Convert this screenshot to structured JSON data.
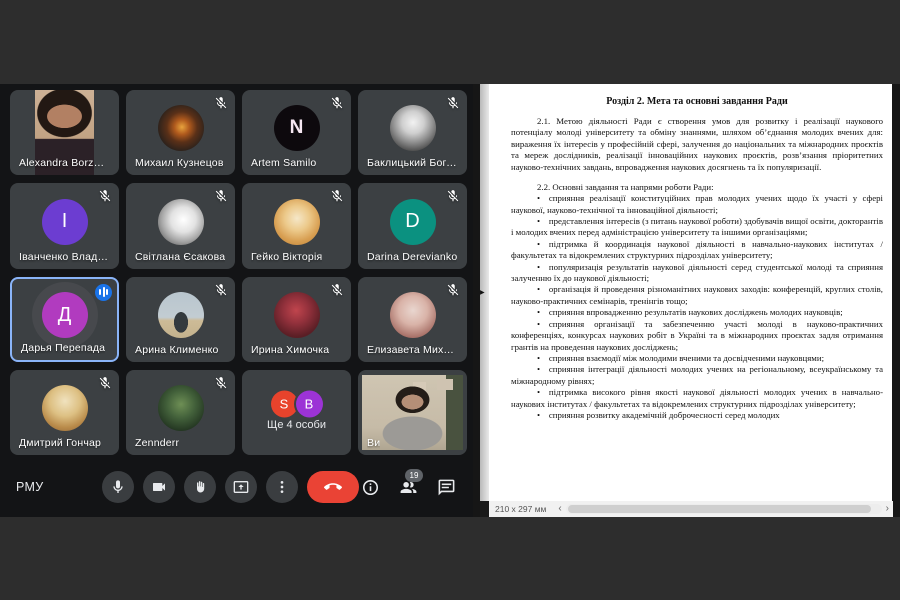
{
  "meet": {
    "room_label": "РМУ",
    "people_count_badge": "19",
    "participants": [
      {
        "name": "Alexandra Borzova",
        "kind": "video"
      },
      {
        "name": "Михаил Кузнецов",
        "kind": "photo",
        "muted": true
      },
      {
        "name": "Artem Samilo",
        "kind": "logo",
        "initial": "N",
        "muted": true
      },
      {
        "name": "Баклицький Богдан",
        "kind": "photo",
        "muted": true
      },
      {
        "name": "Іванченко Владисл...",
        "kind": "initial",
        "initial": "І",
        "color": "#6c3dd1",
        "muted": true
      },
      {
        "name": "Світлана Єсакова",
        "kind": "photo",
        "muted": true
      },
      {
        "name": "Гейко Вікторія",
        "kind": "photo",
        "muted": true
      },
      {
        "name": "Darina Derevianko",
        "kind": "initial",
        "initial": "D",
        "color": "#0b9180",
        "muted": true
      },
      {
        "name": "Дарья Перепада",
        "kind": "initial",
        "initial": "Д",
        "color": "#b13bbf",
        "speaking": true
      },
      {
        "name": "Арина Клименко",
        "kind": "photo",
        "muted": true
      },
      {
        "name": "Ирина Химочка",
        "kind": "photo",
        "muted": true
      },
      {
        "name": "Елизавета Михайл...",
        "kind": "photo",
        "muted": true
      },
      {
        "name": "Дмитрий Гончар",
        "kind": "photo",
        "muted": true
      },
      {
        "name": "Zennderr",
        "kind": "photo",
        "muted": true
      },
      {
        "name": "Ще 4 особи",
        "kind": "overflow",
        "circles": [
          {
            "letter": "S",
            "color": "#e8432c"
          },
          {
            "letter": "B",
            "color": "#9c33d6"
          }
        ]
      },
      {
        "name": "Ви",
        "kind": "video"
      }
    ],
    "colors": {
      "speaking_border": "#8ab4f8",
      "speaking_badge": "#1a73e8",
      "end_call_red": "#ea4335",
      "tile_gray": "#3c4043"
    }
  },
  "doc": {
    "title": "Розділ 2. Мета та основні завдання Ради",
    "para_2_1": "2.1. Метою діяльності Ради є створення умов для розвитку і реалізації наукового потенціалу молоді університету та обміну знаннями, шляхом об’єднання молодих вчених для: вираження їх інтересів у професійній сфері, залучення до національних та міжнародних проєктів та мереж дослідників, реалізації інноваційних наукових проєктів, розв’язання пріоритетних науково-технічних завдань, впровадження наукових досягнень та їх популяризації.",
    "para_2_2": "2.2. Основні завдання та напрями роботи Ради:",
    "bullets": [
      "сприяння реалізації конституційних прав молодих учених щодо їх участі у сфері наукової, науково-технічної та інноваційної діяльності;",
      "представлення інтересів (з питань наукової роботи) здобувачів вищої освіти, докторантів і молодих вчених перед адміністрацією університету та іншими організаціями;",
      "підтримка й координація наукової діяльності в навчально-наукових інститутах / факультетах та відокремлених структурних підрозділах університету;",
      "популяризація результатів наукової діяльності серед студентської молоді та сприяння залученню їх до наукової діяльності;",
      "організація й проведення різноманітних наукових заходів: конференцій, круглих столів, науково-практичних семінарів, тренінгів тощо;",
      "сприяння впровадженню результатів наукових досліджень молодих науковців;",
      "сприяння організації та забезпеченню участі молоді в науково-практичних конференціях, конкурсах наукових робіт в Україні та в міжнародних проєктах задля отримання грантів на проведення наукових досліджень;",
      "сприяння взаємодії між молодими вченими та досвідченими науковцями;",
      "сприяння інтеграції діяльності молодих учених на регіональному, всеукраїнському та міжнародному рівнях;",
      "підтримка високого рівня якості наукової діяльності молодих учених в навчально-наукових інститутах / факультетах та відокремлених структурних підрозділах університету;",
      "сприяння розвитку академічній доброчесності серед молодих"
    ],
    "page_size": "210 x 297 мм"
  }
}
